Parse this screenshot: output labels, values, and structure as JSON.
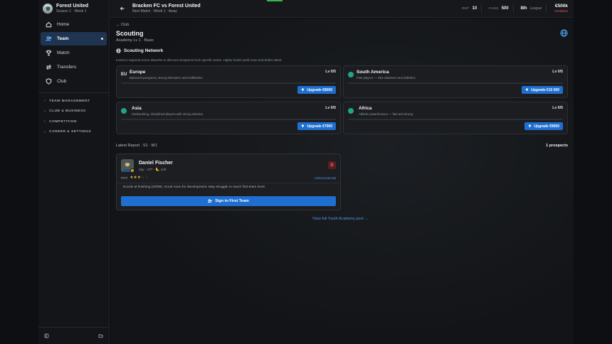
{
  "club": {
    "name": "Forest United",
    "season": "Season 1 · Week 1"
  },
  "nav": [
    {
      "label": "Home",
      "icon": "home-icon"
    },
    {
      "label": "Team",
      "icon": "users-icon",
      "active": true
    },
    {
      "label": "Match",
      "icon": "trophy-icon"
    },
    {
      "label": "Transfers",
      "icon": "transfers-icon"
    },
    {
      "label": "Club",
      "icon": "shield-icon"
    }
  ],
  "groups": [
    "TEAM MANAGEMENT",
    "CLUB & BUSINESS",
    "COMPETITION",
    "CAREER & SETTINGS"
  ],
  "topbar": {
    "match_title": "Bracken FC vs Forest United",
    "match_sub": "Next Match · Week 1 · Away",
    "rep_label": "REP",
    "rep_value": "10",
    "fans_label": "FANS",
    "fans_value": "500",
    "position": "8th",
    "position_label": "League",
    "money": "€500k",
    "money_change": "-€2065/w"
  },
  "page": {
    "breadcrumb": "← Club",
    "title": "Scouting",
    "subtitle": "Academy Lv 1 · Basic",
    "section": "Scouting Network",
    "section_desc": "Invest in regional scout networks to discover prospects from specific areas. Higher levels yield more and better talent."
  },
  "regions": [
    {
      "code": "EU",
      "name": "Europe",
      "desc": "Balanced prospects, strong defenders and midfielders.",
      "level": "Lv 0/5",
      "upgrade": "Upgrade €8000",
      "progress": 0
    },
    {
      "code": "",
      "name": "South America",
      "desc": "Flair players — elite attackers and dribblers.",
      "level": "Lv 0/5",
      "upgrade": "Upgrade €10 000",
      "progress": 0
    },
    {
      "code": "",
      "name": "Asia",
      "desc": "Hardworking, disciplined players with strong stamina.",
      "level": "Lv 0/5",
      "upgrade": "Upgrade €7000",
      "progress": 0
    },
    {
      "code": "",
      "name": "Africa",
      "desc": "Athletic powerhouses — fast and strong.",
      "level": "Lv 0/5",
      "upgrade": "Upgrade €9000",
      "progress": 0
    }
  ],
  "report": {
    "label": "Latest Report · S1 · W1",
    "prospects": "1 prospects",
    "player_name": "Daniel Fischer",
    "meta": "16y · ATT · 🦶 Left",
    "grade": "D",
    "pot_label": "POT",
    "stars_on": "★★★",
    "stars_off": "☆☆",
    "potential": "Limited potential",
    "note": "Excels at finishing (20/99). Good room for development. May struggle to reach first-team level.",
    "sign_label": "Sign to First Team"
  },
  "view_link": "View full Youth Academy pool →"
}
